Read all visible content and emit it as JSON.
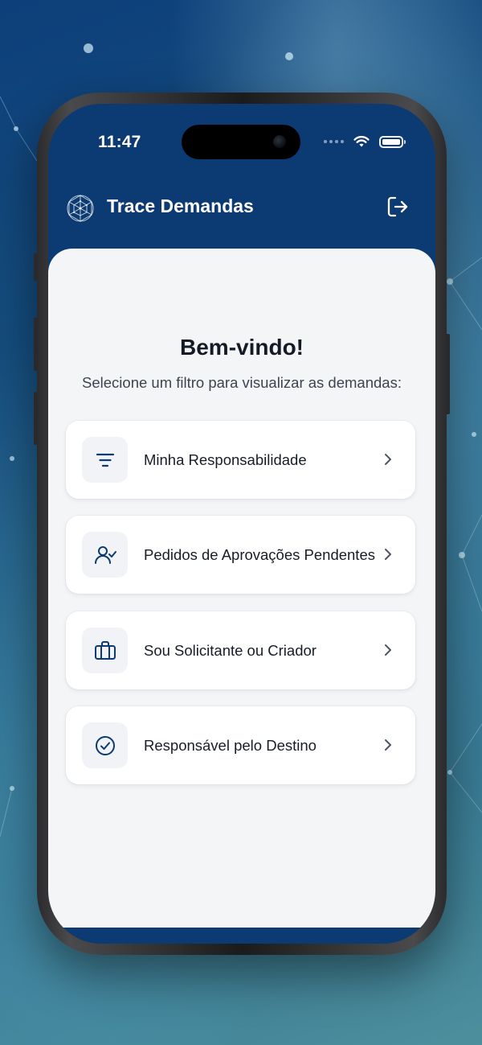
{
  "status_bar": {
    "time": "11:47"
  },
  "header": {
    "title": "Trace Demandas"
  },
  "main": {
    "title": "Bem-vindo!",
    "subtitle": "Selecione um filtro para visualizar as demandas:",
    "filters": [
      {
        "label": "Minha Responsabilidade",
        "icon": "filter-lines-icon"
      },
      {
        "label": "Pedidos de Aprovações Pendentes",
        "icon": "user-check-icon"
      },
      {
        "label": "Sou Solicitante ou Criador",
        "icon": "briefcase-icon"
      },
      {
        "label": "Responsável pelo Destino",
        "icon": "check-circle-icon"
      }
    ]
  },
  "colors": {
    "brand": "#0c3a73",
    "content_background": "#f3f5f7",
    "card_background": "#ffffff",
    "icon_stroke": "#0c3a73"
  }
}
